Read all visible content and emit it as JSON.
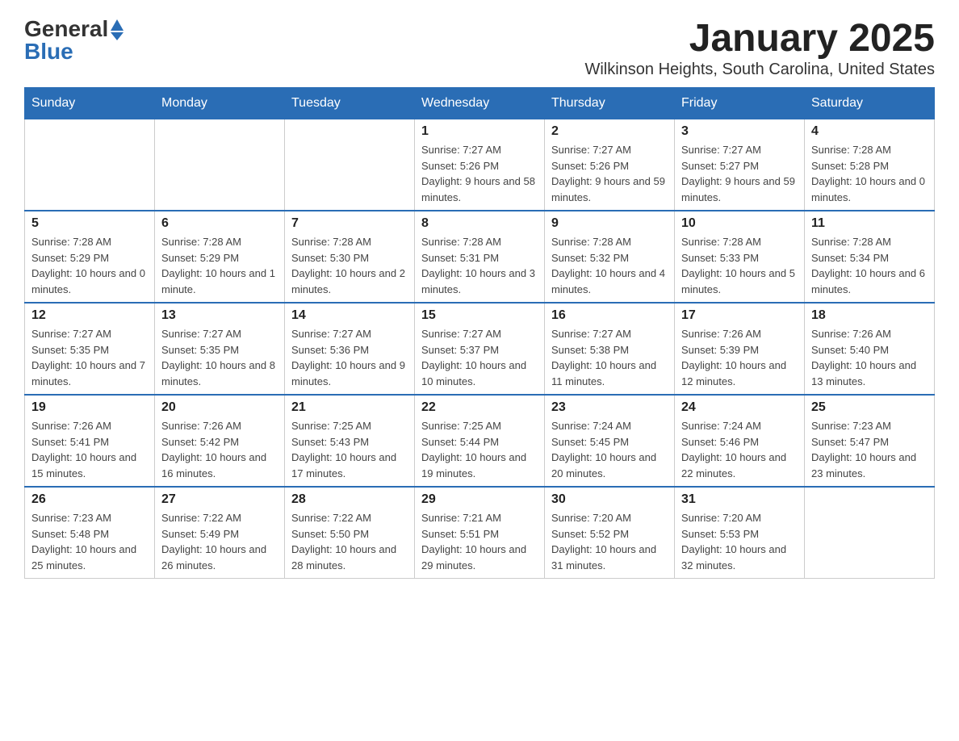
{
  "header": {
    "logo_general": "General",
    "logo_blue": "Blue",
    "title": "January 2025",
    "subtitle": "Wilkinson Heights, South Carolina, United States"
  },
  "days_of_week": [
    "Sunday",
    "Monday",
    "Tuesday",
    "Wednesday",
    "Thursday",
    "Friday",
    "Saturday"
  ],
  "weeks": [
    [
      {
        "day": "",
        "info": ""
      },
      {
        "day": "",
        "info": ""
      },
      {
        "day": "",
        "info": ""
      },
      {
        "day": "1",
        "info": "Sunrise: 7:27 AM\nSunset: 5:26 PM\nDaylight: 9 hours\nand 58 minutes."
      },
      {
        "day": "2",
        "info": "Sunrise: 7:27 AM\nSunset: 5:26 PM\nDaylight: 9 hours\nand 59 minutes."
      },
      {
        "day": "3",
        "info": "Sunrise: 7:27 AM\nSunset: 5:27 PM\nDaylight: 9 hours\nand 59 minutes."
      },
      {
        "day": "4",
        "info": "Sunrise: 7:28 AM\nSunset: 5:28 PM\nDaylight: 10 hours\nand 0 minutes."
      }
    ],
    [
      {
        "day": "5",
        "info": "Sunrise: 7:28 AM\nSunset: 5:29 PM\nDaylight: 10 hours\nand 0 minutes."
      },
      {
        "day": "6",
        "info": "Sunrise: 7:28 AM\nSunset: 5:29 PM\nDaylight: 10 hours\nand 1 minute."
      },
      {
        "day": "7",
        "info": "Sunrise: 7:28 AM\nSunset: 5:30 PM\nDaylight: 10 hours\nand 2 minutes."
      },
      {
        "day": "8",
        "info": "Sunrise: 7:28 AM\nSunset: 5:31 PM\nDaylight: 10 hours\nand 3 minutes."
      },
      {
        "day": "9",
        "info": "Sunrise: 7:28 AM\nSunset: 5:32 PM\nDaylight: 10 hours\nand 4 minutes."
      },
      {
        "day": "10",
        "info": "Sunrise: 7:28 AM\nSunset: 5:33 PM\nDaylight: 10 hours\nand 5 minutes."
      },
      {
        "day": "11",
        "info": "Sunrise: 7:28 AM\nSunset: 5:34 PM\nDaylight: 10 hours\nand 6 minutes."
      }
    ],
    [
      {
        "day": "12",
        "info": "Sunrise: 7:27 AM\nSunset: 5:35 PM\nDaylight: 10 hours\nand 7 minutes."
      },
      {
        "day": "13",
        "info": "Sunrise: 7:27 AM\nSunset: 5:35 PM\nDaylight: 10 hours\nand 8 minutes."
      },
      {
        "day": "14",
        "info": "Sunrise: 7:27 AM\nSunset: 5:36 PM\nDaylight: 10 hours\nand 9 minutes."
      },
      {
        "day": "15",
        "info": "Sunrise: 7:27 AM\nSunset: 5:37 PM\nDaylight: 10 hours\nand 10 minutes."
      },
      {
        "day": "16",
        "info": "Sunrise: 7:27 AM\nSunset: 5:38 PM\nDaylight: 10 hours\nand 11 minutes."
      },
      {
        "day": "17",
        "info": "Sunrise: 7:26 AM\nSunset: 5:39 PM\nDaylight: 10 hours\nand 12 minutes."
      },
      {
        "day": "18",
        "info": "Sunrise: 7:26 AM\nSunset: 5:40 PM\nDaylight: 10 hours\nand 13 minutes."
      }
    ],
    [
      {
        "day": "19",
        "info": "Sunrise: 7:26 AM\nSunset: 5:41 PM\nDaylight: 10 hours\nand 15 minutes."
      },
      {
        "day": "20",
        "info": "Sunrise: 7:26 AM\nSunset: 5:42 PM\nDaylight: 10 hours\nand 16 minutes."
      },
      {
        "day": "21",
        "info": "Sunrise: 7:25 AM\nSunset: 5:43 PM\nDaylight: 10 hours\nand 17 minutes."
      },
      {
        "day": "22",
        "info": "Sunrise: 7:25 AM\nSunset: 5:44 PM\nDaylight: 10 hours\nand 19 minutes."
      },
      {
        "day": "23",
        "info": "Sunrise: 7:24 AM\nSunset: 5:45 PM\nDaylight: 10 hours\nand 20 minutes."
      },
      {
        "day": "24",
        "info": "Sunrise: 7:24 AM\nSunset: 5:46 PM\nDaylight: 10 hours\nand 22 minutes."
      },
      {
        "day": "25",
        "info": "Sunrise: 7:23 AM\nSunset: 5:47 PM\nDaylight: 10 hours\nand 23 minutes."
      }
    ],
    [
      {
        "day": "26",
        "info": "Sunrise: 7:23 AM\nSunset: 5:48 PM\nDaylight: 10 hours\nand 25 minutes."
      },
      {
        "day": "27",
        "info": "Sunrise: 7:22 AM\nSunset: 5:49 PM\nDaylight: 10 hours\nand 26 minutes."
      },
      {
        "day": "28",
        "info": "Sunrise: 7:22 AM\nSunset: 5:50 PM\nDaylight: 10 hours\nand 28 minutes."
      },
      {
        "day": "29",
        "info": "Sunrise: 7:21 AM\nSunset: 5:51 PM\nDaylight: 10 hours\nand 29 minutes."
      },
      {
        "day": "30",
        "info": "Sunrise: 7:20 AM\nSunset: 5:52 PM\nDaylight: 10 hours\nand 31 minutes."
      },
      {
        "day": "31",
        "info": "Sunrise: 7:20 AM\nSunset: 5:53 PM\nDaylight: 10 hours\nand 32 minutes."
      },
      {
        "day": "",
        "info": ""
      }
    ]
  ]
}
